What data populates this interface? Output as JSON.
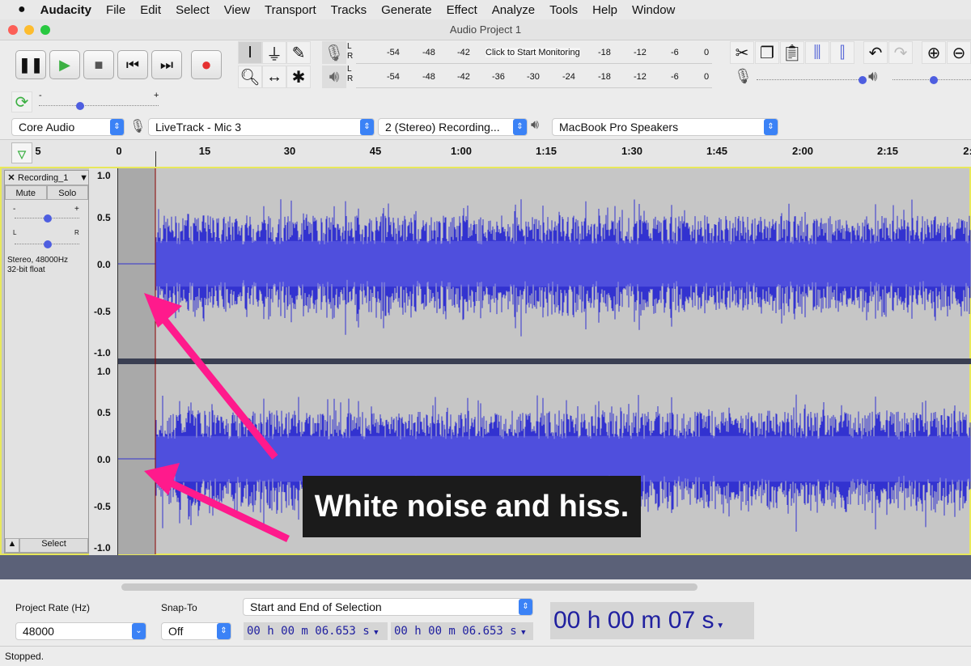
{
  "menubar": {
    "apple": "",
    "items": [
      "Audacity",
      "File",
      "Edit",
      "Select",
      "View",
      "Transport",
      "Tracks",
      "Generate",
      "Effect",
      "Analyze",
      "Tools",
      "Help",
      "Window"
    ]
  },
  "window": {
    "title": "Audio Project 1"
  },
  "transport": {
    "buttons": [
      "pause",
      "play",
      "stop",
      "skip-to-start",
      "skip-to-end",
      "record"
    ]
  },
  "meters": {
    "record_ticks": [
      "-54",
      "-48",
      "-42",
      "Click to Start Monitoring",
      "-18",
      "-12",
      "-6",
      "0"
    ],
    "play_ticks": [
      "-54",
      "-48",
      "-42",
      "-36",
      "-30",
      "-24",
      "-18",
      "-12",
      "-6",
      "0"
    ],
    "lr": [
      "L",
      "R"
    ]
  },
  "devices": {
    "host": "Core Audio",
    "input": "LiveTrack - Mic 3",
    "channels": "2 (Stereo) Recording...",
    "output": "MacBook Pro Speakers"
  },
  "slider": {
    "minus": "-",
    "plus": "+",
    "playback_speed": 0.35,
    "record_volume": 1.0,
    "play_volume": 0.4
  },
  "ruler": {
    "ticks": [
      "5",
      "0",
      "15",
      "30",
      "45",
      "1:00",
      "1:15",
      "1:30",
      "1:45",
      "2:00",
      "2:15",
      "2:"
    ]
  },
  "track": {
    "name": "Recording_1",
    "mute": "Mute",
    "solo": "Solo",
    "info1": "Stereo, 48000Hz",
    "info2": "32-bit float",
    "select": "Select",
    "pan_l": "L",
    "pan_r": "R",
    "gain_minus": "-",
    "gain_plus": "+",
    "scale": [
      "1.0",
      "0.5",
      "0.0",
      "-0.5",
      "-1.0"
    ]
  },
  "annotation": {
    "text": "White noise and hiss.",
    "color": "#ff1a8c"
  },
  "selection": {
    "rate_label": "Project Rate (Hz)",
    "rate": "48000",
    "snap_label": "Snap-To",
    "snap": "Off",
    "mode": "Start and End of Selection",
    "start": "00 h 00 m 06.653 s",
    "end": "00 h 00 m 06.653 s",
    "audio_pos": "00 h 00 m 07 s"
  },
  "status": "Stopped.",
  "colors": {
    "waveform": "#3232d0",
    "track_bg": "#c0c0c0",
    "pre_bg": "#a9a9a9",
    "selection_border": "#e8e85a"
  }
}
